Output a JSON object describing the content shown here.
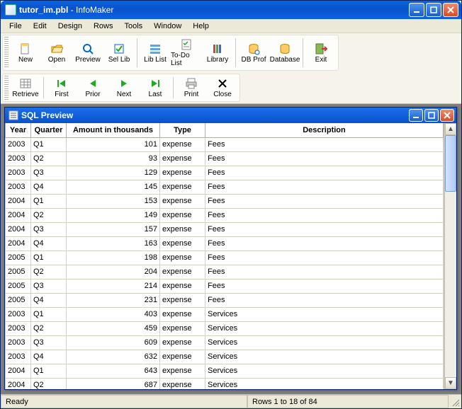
{
  "title": {
    "filename": "tutor_im.pbl",
    "app": "InfoMaker"
  },
  "menu": [
    "File",
    "Edit",
    "Design",
    "Rows",
    "Tools",
    "Window",
    "Help"
  ],
  "toolbar_top": [
    {
      "label": "New",
      "name": "new-button",
      "icon": "new"
    },
    {
      "label": "Open",
      "name": "open-button",
      "icon": "open"
    },
    {
      "label": "Preview",
      "name": "preview-button",
      "icon": "preview"
    },
    {
      "label": "Sel Lib",
      "name": "sel-lib-button",
      "icon": "sellib"
    },
    {
      "sep": true
    },
    {
      "label": "Lib List",
      "name": "lib-list-button",
      "icon": "liblist"
    },
    {
      "label": "To-Do List",
      "name": "todo-list-button",
      "icon": "todo"
    },
    {
      "label": "Library",
      "name": "library-button",
      "icon": "library"
    },
    {
      "sep": true
    },
    {
      "label": "DB Prof",
      "name": "db-prof-button",
      "icon": "dbprof"
    },
    {
      "label": "Database",
      "name": "database-button",
      "icon": "database"
    },
    {
      "sep": true
    },
    {
      "label": "Exit",
      "name": "exit-button",
      "icon": "exit"
    }
  ],
  "toolbar_bottom": [
    {
      "label": "Retrieve",
      "name": "retrieve-button",
      "icon": "retrieve"
    },
    {
      "sep": true
    },
    {
      "label": "First",
      "name": "first-button",
      "icon": "first"
    },
    {
      "label": "Prior",
      "name": "prior-button",
      "icon": "prior"
    },
    {
      "label": "Next",
      "name": "next-button",
      "icon": "next"
    },
    {
      "label": "Last",
      "name": "last-button",
      "icon": "last"
    },
    {
      "sep": true
    },
    {
      "label": "Print",
      "name": "print-button",
      "icon": "print"
    },
    {
      "label": "Close",
      "name": "close-button",
      "icon": "closex"
    }
  ],
  "child": {
    "title": "SQL Preview"
  },
  "grid": {
    "columns": [
      "Year",
      "Quarter",
      "Amount in thousands",
      "Type",
      "Description"
    ],
    "rows": [
      {
        "year": "2003",
        "q": "Q1",
        "amt": "101",
        "type": "expense",
        "desc": "Fees"
      },
      {
        "year": "2003",
        "q": "Q2",
        "amt": "93",
        "type": "expense",
        "desc": "Fees"
      },
      {
        "year": "2003",
        "q": "Q3",
        "amt": "129",
        "type": "expense",
        "desc": "Fees"
      },
      {
        "year": "2003",
        "q": "Q4",
        "amt": "145",
        "type": "expense",
        "desc": "Fees"
      },
      {
        "year": "2004",
        "q": "Q1",
        "amt": "153",
        "type": "expense",
        "desc": "Fees"
      },
      {
        "year": "2004",
        "q": "Q2",
        "amt": "149",
        "type": "expense",
        "desc": "Fees"
      },
      {
        "year": "2004",
        "q": "Q3",
        "amt": "157",
        "type": "expense",
        "desc": "Fees"
      },
      {
        "year": "2004",
        "q": "Q4",
        "amt": "163",
        "type": "expense",
        "desc": "Fees"
      },
      {
        "year": "2005",
        "q": "Q1",
        "amt": "198",
        "type": "expense",
        "desc": "Fees"
      },
      {
        "year": "2005",
        "q": "Q2",
        "amt": "204",
        "type": "expense",
        "desc": "Fees"
      },
      {
        "year": "2005",
        "q": "Q3",
        "amt": "214",
        "type": "expense",
        "desc": "Fees"
      },
      {
        "year": "2005",
        "q": "Q4",
        "amt": "231",
        "type": "expense",
        "desc": "Fees"
      },
      {
        "year": "2003",
        "q": "Q1",
        "amt": "403",
        "type": "expense",
        "desc": "Services"
      },
      {
        "year": "2003",
        "q": "Q2",
        "amt": "459",
        "type": "expense",
        "desc": "Services"
      },
      {
        "year": "2003",
        "q": "Q3",
        "amt": "609",
        "type": "expense",
        "desc": "Services"
      },
      {
        "year": "2003",
        "q": "Q4",
        "amt": "632",
        "type": "expense",
        "desc": "Services"
      },
      {
        "year": "2004",
        "q": "Q1",
        "amt": "643",
        "type": "expense",
        "desc": "Services"
      },
      {
        "year": "2004",
        "q": "Q2",
        "amt": "687",
        "type": "expense",
        "desc": "Services"
      }
    ]
  },
  "status": {
    "ready": "Ready",
    "rows": "Rows 1 to 18 of 84"
  }
}
